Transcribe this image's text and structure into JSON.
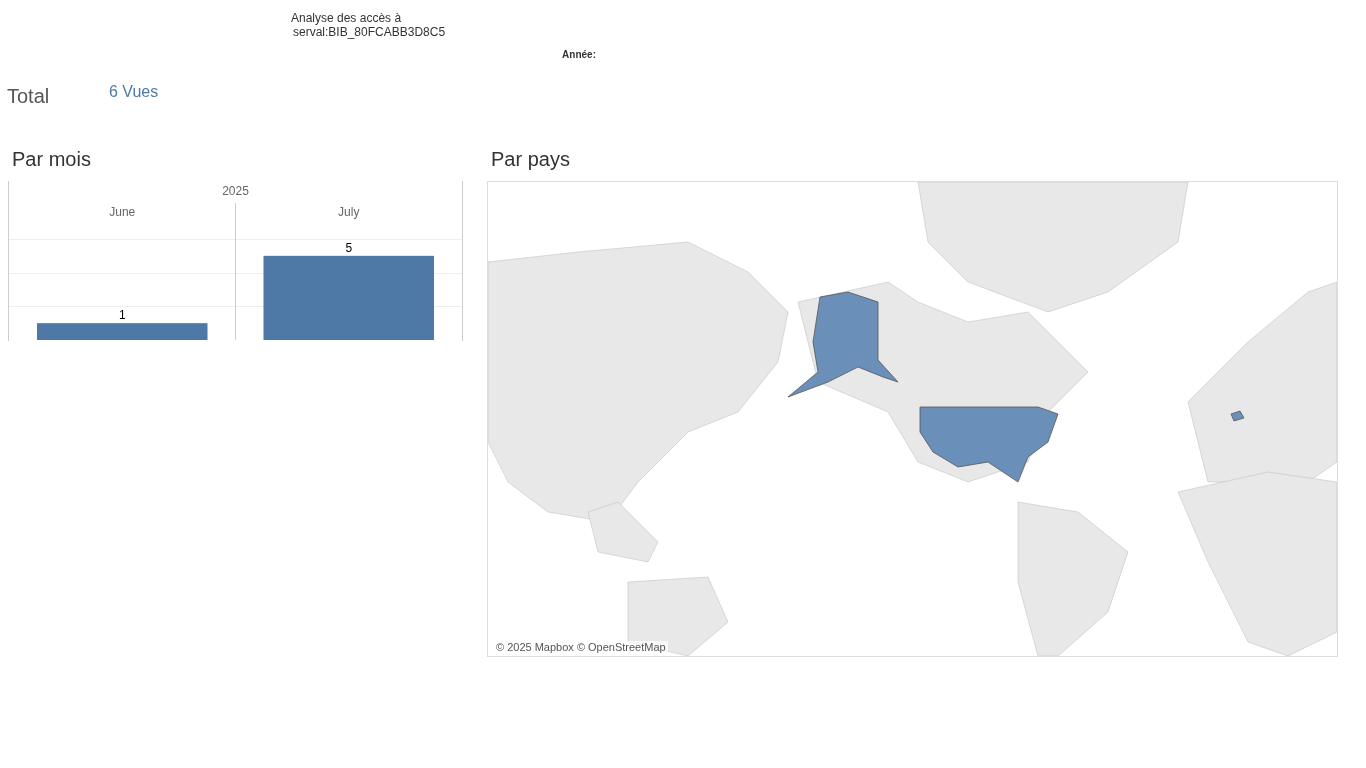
{
  "header": {
    "title_line_1": "Analyse des accès à",
    "title_line_2": "serval:BIB_80FCABB3D8C5",
    "year_filter_label": "Année:"
  },
  "total": {
    "label": "Total",
    "value": "6 Vues"
  },
  "by_month": {
    "title": "Par mois",
    "year_header": "2025",
    "chart_data": {
      "type": "bar",
      "categories": [
        "June",
        "July"
      ],
      "values": [
        1,
        5
      ],
      "data_labels": true
    }
  },
  "by_country": {
    "title": "Par pays",
    "attribution": "© 2025 Mapbox © OpenStreetMap"
  }
}
